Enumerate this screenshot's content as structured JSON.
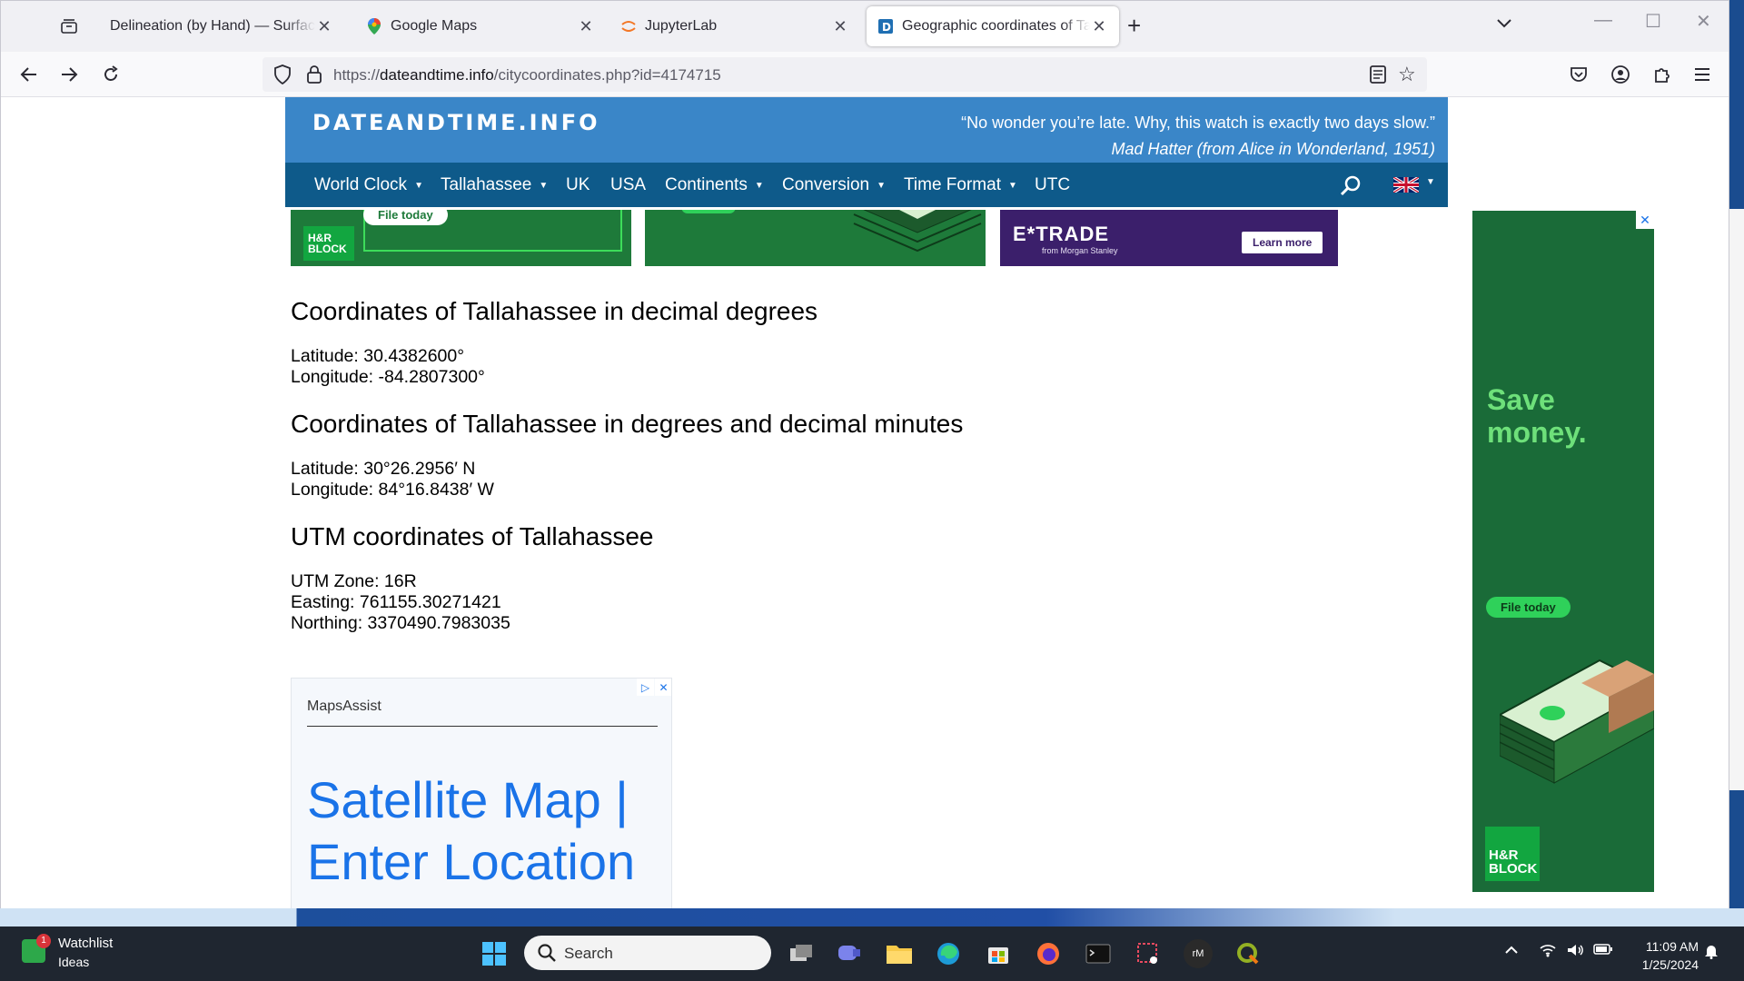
{
  "browser": {
    "tabs": [
      {
        "title": "Delineation (by Hand) — Surface W",
        "close": "✕",
        "active": false
      },
      {
        "title": "Google Maps",
        "close": "✕",
        "active": false
      },
      {
        "title": "JupyterLab",
        "close": "✕",
        "active": false
      },
      {
        "title": "Geographic coordinates of Talla",
        "close": "✕",
        "active": true
      }
    ],
    "new_tab": "+",
    "url_prefix": "https://",
    "url_host": "dateandtime.info",
    "url_path": "/citycoordinates.php?id=4174715"
  },
  "site": {
    "logo": "DATEANDTIME.INFO",
    "quote": "“No wonder you’re late. Why, this watch is exactly two days slow.”",
    "quote_author": "Mad Hatter (from Alice in Wonderland, 1951)",
    "nav": [
      "World Clock",
      "Tallahassee",
      "UK",
      "USA",
      "Continents",
      "Conversion",
      "Time Format",
      "UTC"
    ]
  },
  "ads": {
    "hr_block": "H&R\nBLOCK",
    "hr_cta": "File today",
    "etrade_logo": "E*TRADE",
    "etrade_sub": "from Morgan Stanley",
    "etrade_cta": "Learn more",
    "maps_brand": "MapsAssist",
    "maps_title": "Satellite Map | Enter Location",
    "sky_head": "Save money.",
    "sky_cta": "File today",
    "sky_logo": "H&R BLOCK"
  },
  "content": {
    "decimal": {
      "heading": "Coordinates of Tallahassee in decimal degrees",
      "latitude": "Latitude: 30.4382600°",
      "longitude": "Longitude: -84.2807300°"
    },
    "dm": {
      "heading": "Coordinates of Tallahassee in degrees and decimal minutes",
      "latitude": "Latitude: 30°26.2956′ N",
      "longitude": "Longitude: 84°16.8438′ W"
    },
    "utm": {
      "heading": "UTM coordinates of Tallahassee",
      "zone": "UTM Zone: 16R",
      "easting": "Easting: 761155.30271421",
      "northing": "Northing: 3370490.7983035"
    }
  },
  "taskbar": {
    "watch_title": "Watchlist",
    "watch_sub": "Ideas",
    "watch_badge": "1",
    "search_label": "Search",
    "time": "11:09 AM",
    "date": "1/25/2024"
  }
}
